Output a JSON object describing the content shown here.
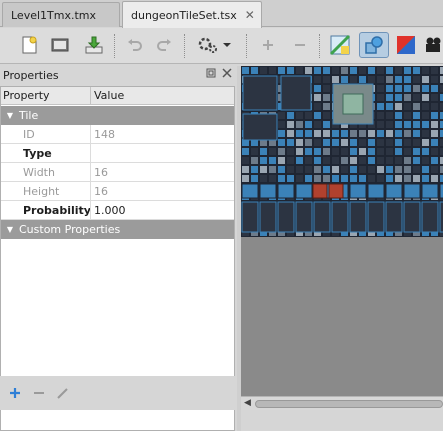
{
  "tabs": [
    {
      "label": "Level1Tmx.tmx",
      "active": false
    },
    {
      "label": "dungeonTileSet.tsx",
      "active": true
    }
  ],
  "toolbar": {
    "icons": [
      "new-icon",
      "open-icon",
      "save-icon",
      "undo-icon",
      "redo-icon",
      "commands-icon",
      "add-icon",
      "remove-icon",
      "tileset-image-icon",
      "collision-editor-icon",
      "color-picker-icon",
      "animation-editor-icon"
    ]
  },
  "properties": {
    "title": "Properties",
    "columns": {
      "property": "Property",
      "value": "Value"
    },
    "groups": [
      {
        "name": "Tile",
        "rows": [
          {
            "key": "ID",
            "value": "148",
            "disabled": true
          },
          {
            "key": "Type",
            "value": "",
            "disabled": false
          },
          {
            "key": "Width",
            "value": "16",
            "disabled": true
          },
          {
            "key": "Height",
            "value": "16",
            "disabled": true
          },
          {
            "key": "Probability",
            "value": "1.000",
            "disabled": false
          }
        ]
      },
      {
        "name": "Custom Properties",
        "rows": []
      }
    ]
  },
  "colors": {
    "accent": "#2f7fd6",
    "group_header": "#9b9b9b",
    "tile_blue": "#3b82b8",
    "tile_dark": "#2c3442"
  }
}
